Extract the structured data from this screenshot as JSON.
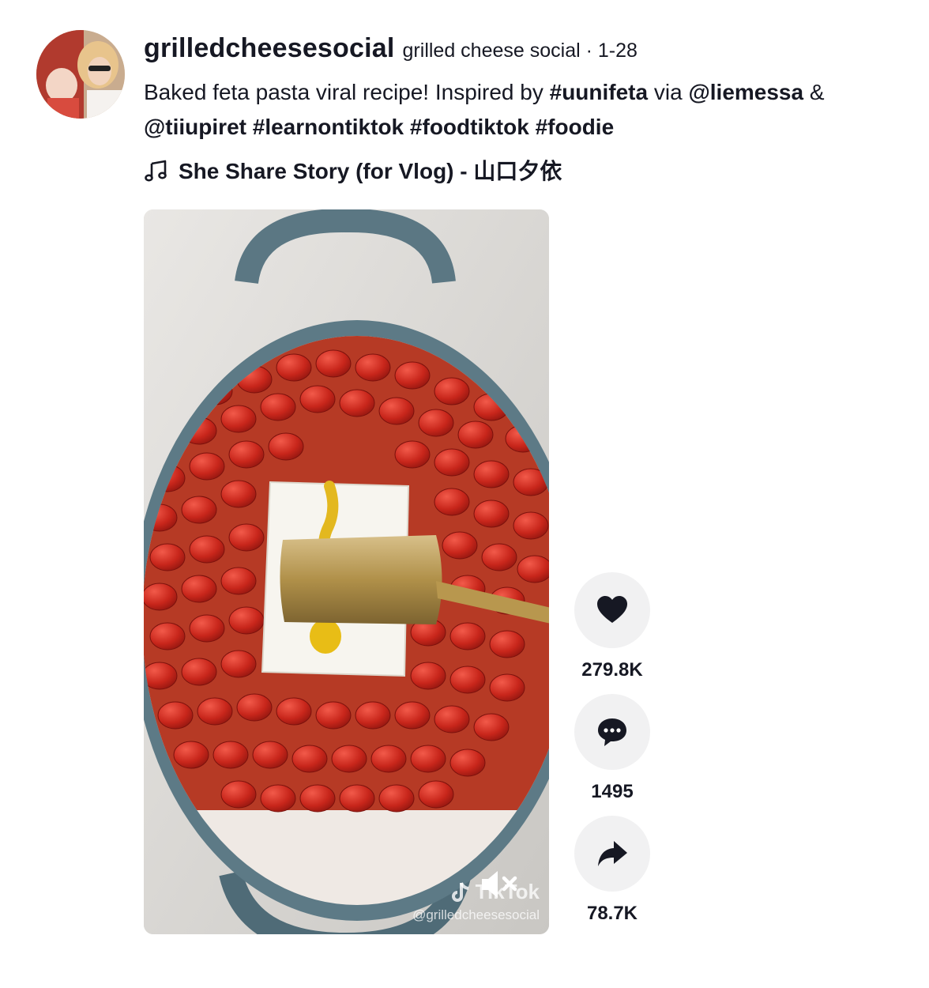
{
  "author": {
    "username": "grilledcheesesocial",
    "display_name": "grilled cheese social",
    "separator": "·",
    "date": "1-28"
  },
  "description": {
    "text_1": "Baked feta pasta viral recipe! Inspired by ",
    "hashtag_1": "#uunifeta",
    "text_2": " via ",
    "mention_1": "@liemessa",
    "text_3": " & ",
    "mention_2": "@tiiupiret",
    "hashtag_2": "#learnontiktok",
    "hashtag_3": "#foodtiktok",
    "hashtag_4": "#foodie"
  },
  "music": {
    "icon": "music-note-icon",
    "title": "She Share Story (for Vlog) - 山口夕依"
  },
  "video": {
    "watermark_brand": "TikTok",
    "watermark_handle": "@grilledcheesesocial",
    "mute_icon": "volume-muted-icon"
  },
  "actions": {
    "likes": "279.8K",
    "comments": "1495",
    "shares": "78.7K"
  },
  "colors": {
    "accent_red": "#d32b21",
    "button_bg": "#f1f1f2",
    "text": "#161823"
  }
}
